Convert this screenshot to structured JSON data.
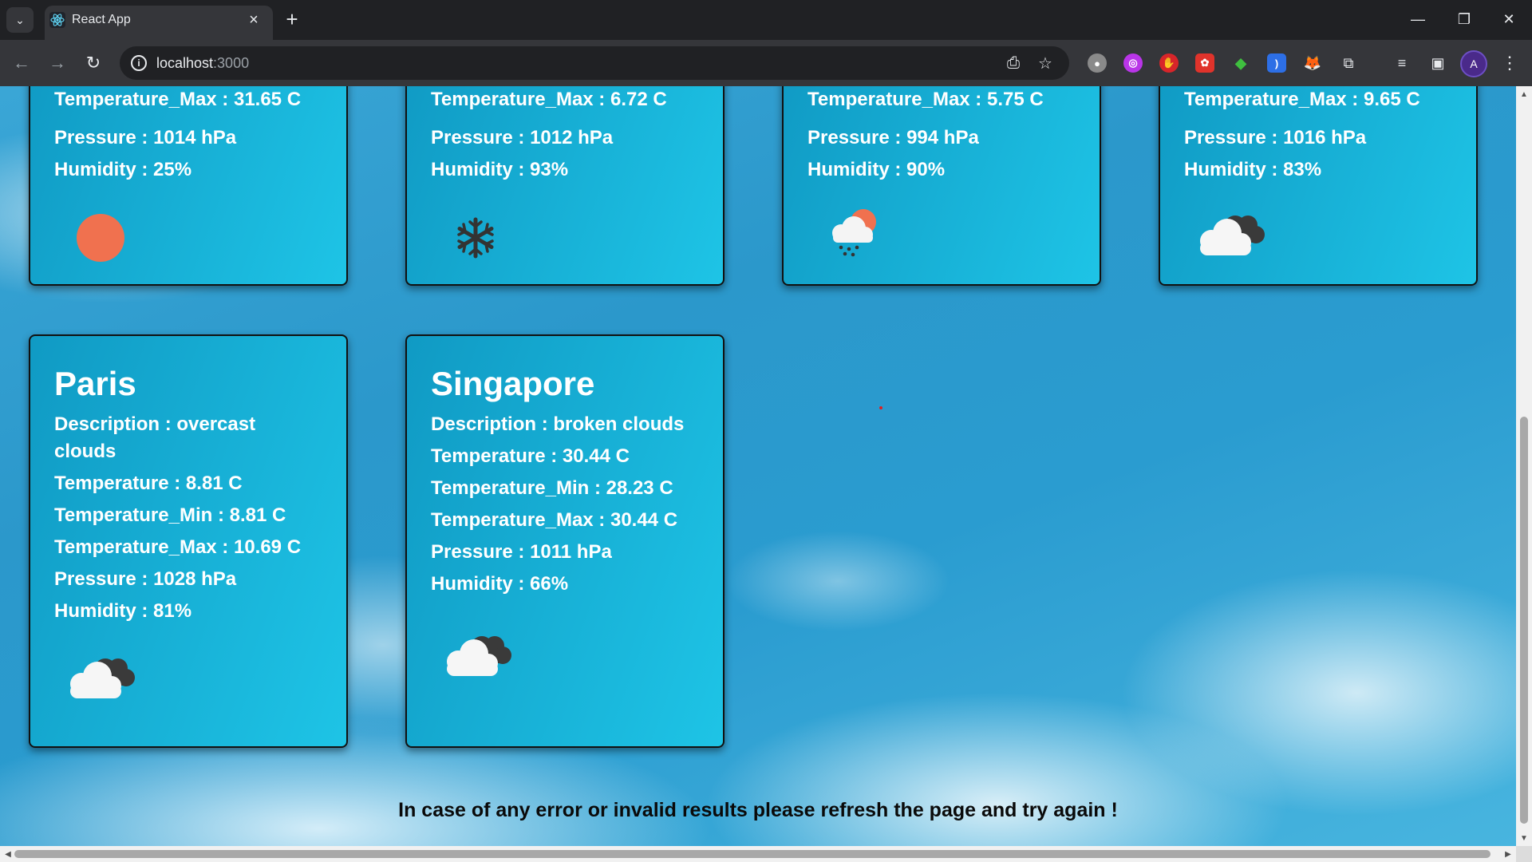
{
  "browser": {
    "tab_title": "React App",
    "url_host": "localhost",
    "url_port": ":3000",
    "profile_initial": "A"
  },
  "cards_top": [
    {
      "partial_line": "Temperature_Max : 31.65 C",
      "pressure": "Pressure : 1014 hPa",
      "humidity": "Humidity : 25%",
      "icon": "sun-icon"
    },
    {
      "partial_line": "Temperature_Max : 6.72 C",
      "pressure": "Pressure : 1012 hPa",
      "humidity": "Humidity : 93%",
      "icon": "snowflake-icon"
    },
    {
      "partial_line": "Temperature_Max : 5.75 C",
      "pressure": "Pressure : 994 hPa",
      "humidity": "Humidity : 90%",
      "icon": "rain-sun-cloud-icon"
    },
    {
      "partial_line": "Temperature_Max : 9.65 C",
      "pressure": "Pressure : 1016 hPa",
      "humidity": "Humidity : 83%",
      "icon": "broken-clouds-icon"
    }
  ],
  "cards": [
    {
      "city": "Paris",
      "description": "Description : overcast",
      "description_cont": "clouds",
      "temperature": "Temperature : 8.81 C",
      "temp_min": "Temperature_Min : 8.81 C",
      "temp_max": "Temperature_Max : 10.69 C",
      "pressure": "Pressure : 1028 hPa",
      "humidity": "Humidity : 81%",
      "icon": "overcast-clouds-icon"
    },
    {
      "city": "Singapore",
      "description": "Description : broken clouds",
      "temperature": "Temperature : 30.44 C",
      "temp_min": "Temperature_Min : 28.23 C",
      "temp_max": "Temperature_Max : 30.44 C",
      "pressure": "Pressure : 1011 hPa",
      "humidity": "Humidity : 66%",
      "icon": "broken-clouds-icon"
    }
  ],
  "footer": {
    "note": "In case of any error or invalid results please refresh the page and try again !"
  }
}
